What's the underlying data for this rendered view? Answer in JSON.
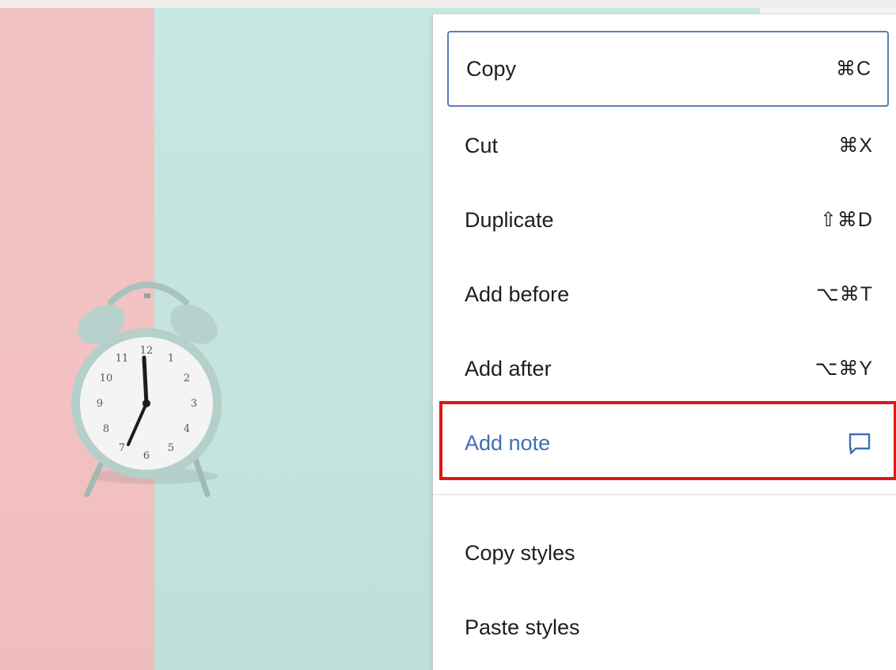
{
  "menu": {
    "items": [
      {
        "label": "Copy",
        "shortcut": "⌘C"
      },
      {
        "label": "Cut",
        "shortcut": "⌘X"
      },
      {
        "label": "Duplicate",
        "shortcut": "⇧⌘D"
      },
      {
        "label": "Add before",
        "shortcut": "⌥⌘T"
      },
      {
        "label": "Add after",
        "shortcut": "⌥⌘Y"
      },
      {
        "label": "Add note",
        "icon": "comment-icon"
      }
    ],
    "style_items": [
      {
        "label": "Copy styles"
      },
      {
        "label": "Paste styles"
      }
    ]
  },
  "background": {
    "left_panel_color": "#f2c3c4",
    "right_panel_color": "#c6e5e1",
    "clock_numerals": [
      "12",
      "1",
      "2",
      "3",
      "4",
      "5",
      "6",
      "7",
      "8",
      "9",
      "10",
      "11"
    ]
  },
  "colors": {
    "focus_border": "#5b7fb0",
    "highlight_border": "#e01616",
    "accent_text": "#3f6fb5"
  }
}
